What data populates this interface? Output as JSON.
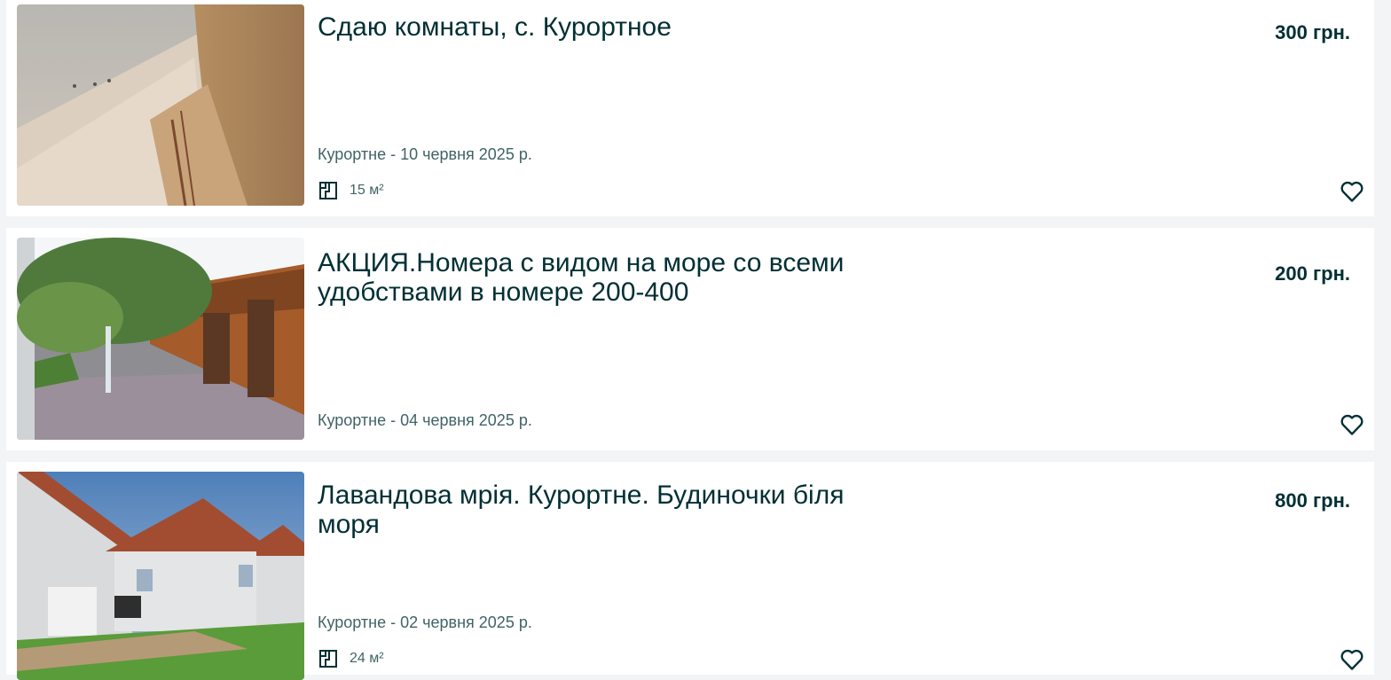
{
  "listings": [
    {
      "title": "Сдаю комнаты, с. Курортное",
      "price": "300 грн.",
      "meta": "Курортне - 10 червня 2025 р.",
      "area": "15 м²",
      "area_icon": "floor-plan-icon",
      "favorite_icon": "heart-outline-icon"
    },
    {
      "title": "АКЦИЯ.Номера с видом на море со всеми удобствами в номере 200-400",
      "price": "200 грн.",
      "meta": "Курортне - 04 червня 2025 р.",
      "favorite_icon": "heart-outline-icon"
    },
    {
      "title": "Лавандова мрія. Курортне. Будиночки біля моря",
      "price": "800 грн.",
      "meta": "Курортне - 02 червня 2025 р.",
      "area": "24 м²",
      "area_icon": "floor-plan-icon",
      "favorite_icon": "heart-outline-icon"
    }
  ],
  "colors": {
    "text": "#002f34",
    "muted": "#406367",
    "card": "#ffffff",
    "page": "#f2f4f5"
  }
}
